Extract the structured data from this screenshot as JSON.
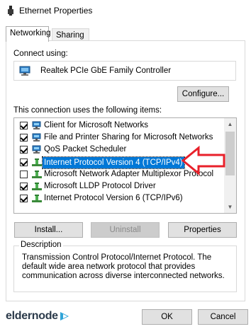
{
  "window": {
    "title": "Ethernet Properties"
  },
  "tabs": [
    {
      "label": "Networking",
      "active": true
    },
    {
      "label": "Sharing",
      "active": false
    }
  ],
  "connect": {
    "label": "Connect using:",
    "adapter": "Realtek PCIe GbE Family Controller",
    "configure_label": "Configure..."
  },
  "items": {
    "label": "This connection uses the following items:",
    "list": [
      {
        "label": "Client for Microsoft Networks",
        "checked": true,
        "icon": "network-client-icon",
        "selected": false
      },
      {
        "label": "File and Printer Sharing for Microsoft Networks",
        "checked": true,
        "icon": "network-client-icon",
        "selected": false
      },
      {
        "label": "QoS Packet Scheduler",
        "checked": true,
        "icon": "network-client-icon",
        "selected": false
      },
      {
        "label": "Internet Protocol Version 4 (TCP/IPv4)",
        "checked": true,
        "icon": "protocol-icon",
        "selected": true
      },
      {
        "label": "Microsoft Network Adapter Multiplexor Protocol",
        "checked": false,
        "icon": "protocol-icon",
        "selected": false
      },
      {
        "label": "Microsoft LLDP Protocol Driver",
        "checked": true,
        "icon": "protocol-icon",
        "selected": false
      },
      {
        "label": "Internet Protocol Version 6 (TCP/IPv6)",
        "checked": true,
        "icon": "protocol-icon",
        "selected": false
      }
    ]
  },
  "buttons": {
    "install": "Install...",
    "uninstall": "Uninstall",
    "properties": "Properties",
    "ok": "OK",
    "cancel": "Cancel"
  },
  "description": {
    "legend": "Description",
    "text": "Transmission Control Protocol/Internet Protocol. The default wide area network protocol that provides communication across diverse interconnected networks."
  },
  "logo": {
    "text": "eldernode"
  },
  "colors": {
    "selection": "#0078d7",
    "annotation_arrow": "#e8202a",
    "logo_text": "#2b3a4a",
    "logo_mark": "#2fa4d8"
  }
}
